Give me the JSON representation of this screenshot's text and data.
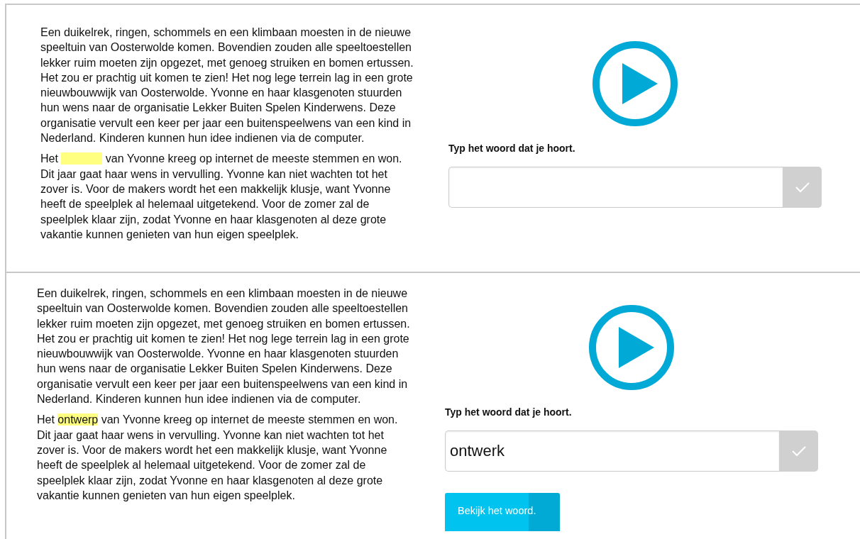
{
  "exercises": [
    {
      "paragraph_1": "Een duikelrek, ringen, schommels en een klimbaan moesten in de nieuwe speeltuin van Oosterwolde komen. Bovendien zouden alle speeltoestellen lekker ruim moeten zijn opgezet, met genoeg struiken en bomen ertussen. Het zou er prachtig uit komen te zien! Het nog lege terrein lag in een grote nieuwbouwwijk van Oosterwolde. Yvonne en haar klasgenoten stuurden hun wens naar de organisatie Lekker Buiten Spelen Kinderwens. Deze organisatie vervult een keer per jaar een buitenspeelwens van een kind in Nederland. Kinderen kunnen hun idee indienen via de computer.",
      "paragraph_2": {
        "before": "Het",
        "gap": {
          "revealed": false
        },
        "after": "van Yvonne kreeg op internet de meeste stemmen en won. Dit jaar gaat haar wens in vervulling. Yvonne kan niet wachten tot het zover is. Voor de makers wordt het een makkelijk klusje, want Yvonne heeft de speelplek al helemaal uitgetekend. Voor de zomer zal de speelplek klaar zijn, zodat Yvonne en haar klasgenoten al deze grote vakantie kunnen genieten van hun eigen speelplek."
      },
      "prompt": "Typ het woord dat je hoort."
    },
    {
      "paragraph_1": "Een duikelrek, ringen, schommels en een klimbaan moesten in de nieuwe speeltuin van Oosterwolde komen. Bovendien zouden alle speeltoestellen lekker ruim moeten zijn opgezet, met genoeg struiken en bomen ertussen. Het zou er prachtig uit komen te zien! Het nog lege terrein lag in een grote nieuwbouwwijk van Oosterwolde. Yvonne en haar klasgenoten stuurden hun wens naar de organisatie Lekker Buiten Spelen Kinderwens. Deze organisatie vervult een keer per jaar een buitenspeelwens van een kind in Nederland. Kinderen kunnen hun idee indienen via de computer.",
      "paragraph_2": {
        "before": "Het",
        "gap": {
          "revealed": true,
          "word": "ontwerp"
        },
        "after": "van Yvonne kreeg op internet de meeste stemmen en won. Dit jaar gaat haar wens in vervulling. Yvonne kan niet wachten tot het zover is. Voor de makers wordt het een makkelijk klusje, want Yvonne heeft de speelplek al helemaal uitgetekend. Voor de zomer zal de speelplek klaar zijn, zodat Yvonne en haar klasgenoten al deze grote vakantie kunnen genieten van hun eigen speelplek."
      },
      "prompt": "Typ het woord dat je hoort.",
      "answer": "ontwerk",
      "show_button": "Bekijk het woord."
    }
  ]
}
